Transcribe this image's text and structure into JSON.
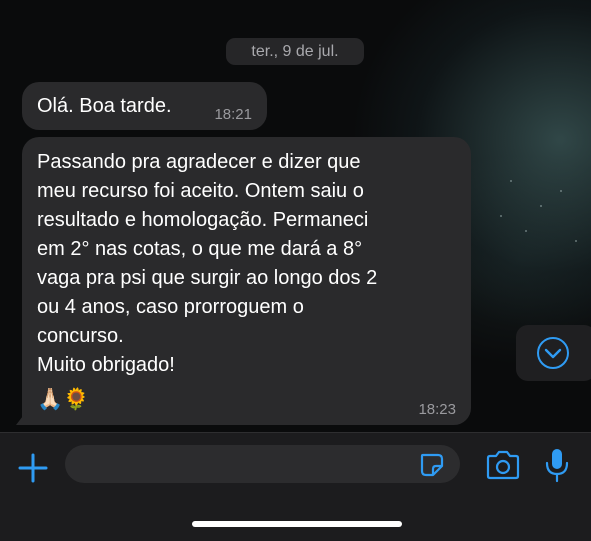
{
  "chat": {
    "date_label": "ter., 9 de jul.",
    "messages": [
      {
        "text": "Olá. Boa tarde.",
        "time": "18:21"
      },
      {
        "text": "Passando pra agradecer e dizer que\nmeu recurso foi aceito. Ontem saiu o\nresultado e homologação. Permaneci\nem 2° nas cotas, o que me dará a 8°\nvaga pra psi que surgir ao longo dos 2\nou 4 anos, caso prorroguem o\nconcurso.\nMuito obrigado!",
        "emoji": "🙏🏻🌻",
        "time": "18:23"
      }
    ]
  },
  "composer": {
    "placeholder": "",
    "icons": {
      "attach": "plus-icon",
      "sticker": "sticker-icon",
      "camera": "camera-icon",
      "mic": "microphone-icon",
      "scroll": "chevron-down-icon"
    }
  },
  "colors": {
    "accent": "#2f9bf3",
    "bubble": "#2a2a2c",
    "background": "#0b0b0c"
  }
}
